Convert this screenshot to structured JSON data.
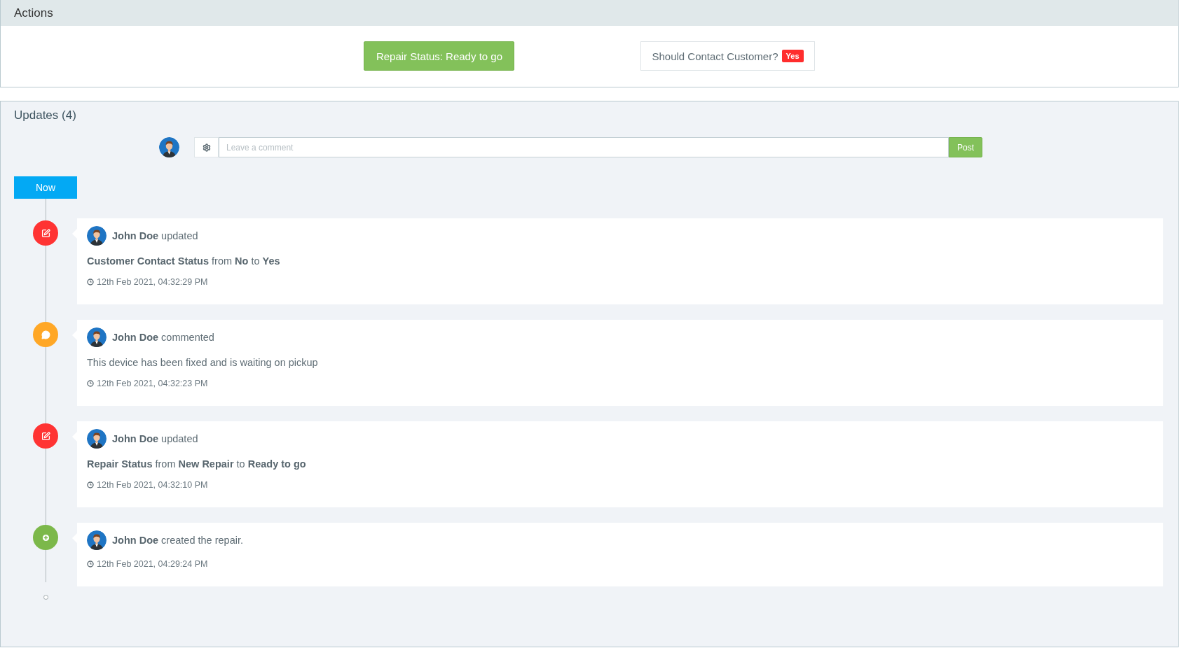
{
  "actions": {
    "title": "Actions",
    "repair_status_button": "Repair Status: Ready to go",
    "contact_label": "Should Contact Customer?",
    "contact_badge": "Yes"
  },
  "updates": {
    "title": "Updates (4)",
    "comment_field": {
      "placeholder": "Leave a comment"
    },
    "post_button": "Post",
    "now_label": "Now",
    "items": [
      {
        "kind": "update",
        "color": "#ff3333",
        "header": "**John Doe** updated",
        "body": "**Customer Contact Status** from **No** to **Yes**",
        "time": "12th Feb 2021, 04:32:29 PM"
      },
      {
        "kind": "comment",
        "color": "#ffa726",
        "header": "**John Doe** commented",
        "body": "This device has been fixed and is waiting on pickup",
        "time": "12th Feb 2021, 04:32:23 PM"
      },
      {
        "kind": "update",
        "color": "#ff3333",
        "header": "**John Doe** updated",
        "body": "**Repair Status** from **New Repair** to **Ready to go**",
        "time": "12th Feb 2021, 04:32:10 PM"
      },
      {
        "kind": "created",
        "color": "#7cb84a",
        "header": "**John Doe** created the repair.",
        "time": "12th Feb 2021, 04:29:24 PM"
      }
    ]
  }
}
